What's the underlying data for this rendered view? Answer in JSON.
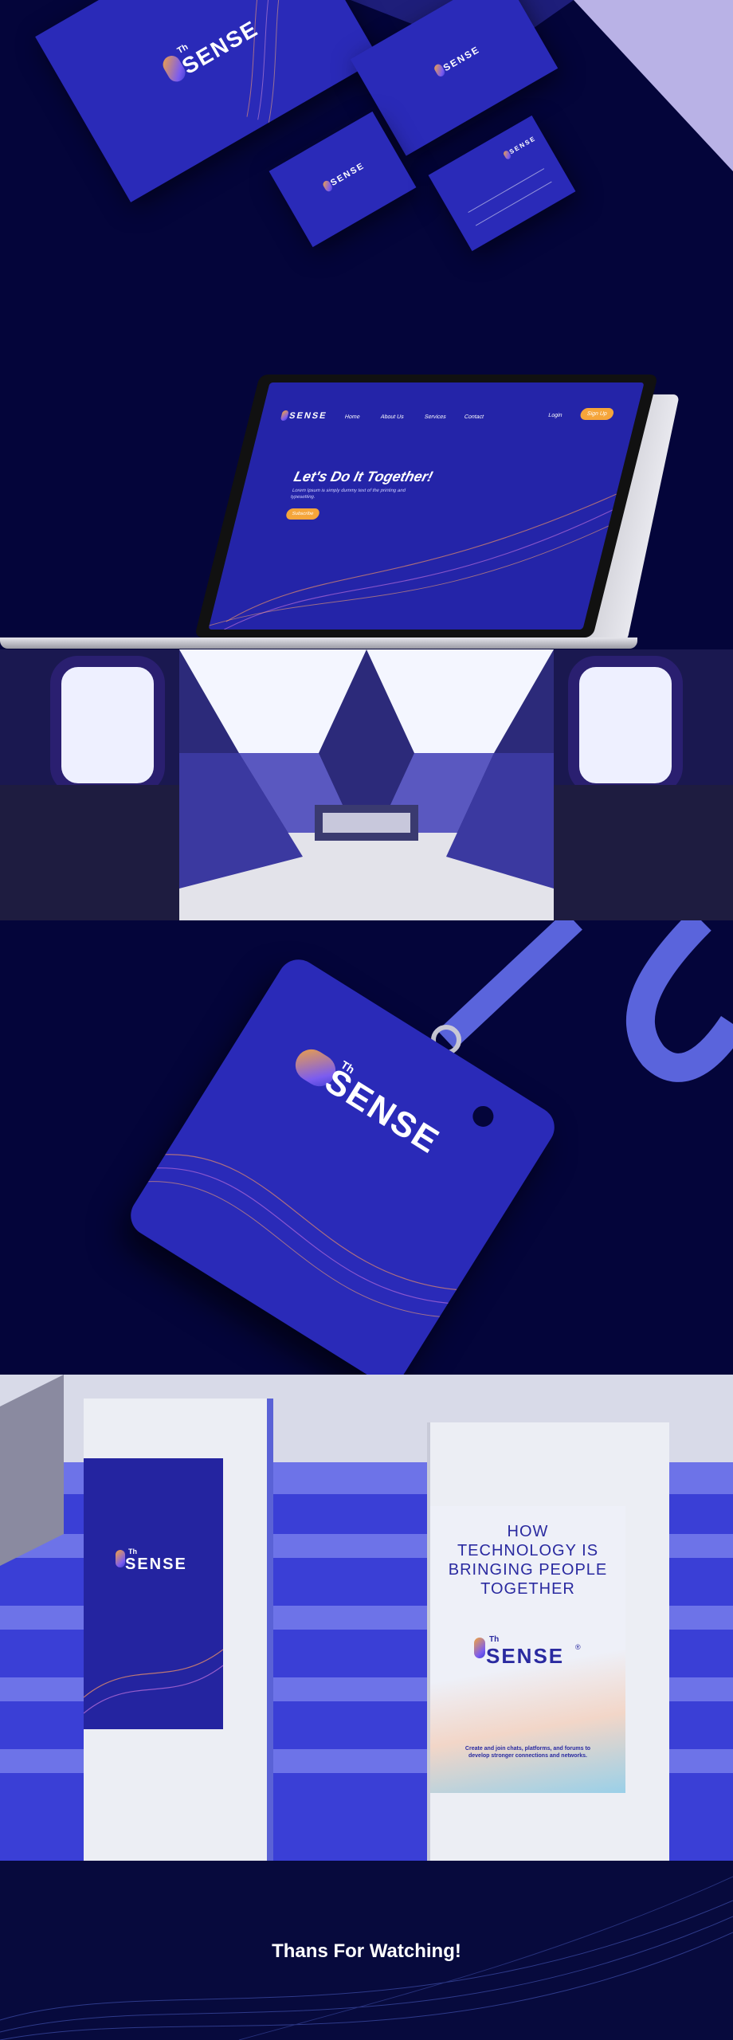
{
  "brand": {
    "super": "Th",
    "word": "SENSE",
    "reg": "®"
  },
  "website": {
    "nav": [
      "Home",
      "About Us",
      "Services",
      "Contact"
    ],
    "login": "Login",
    "signup": "Sign Up",
    "hero": "Let's Do It Together!",
    "body": "Lorem Ipsum is simply dummy text of the printing and typesetting.",
    "cta": "Subscribe"
  },
  "signage": {
    "headline": "HOW TECHNOLOGY IS BRINGING PEOPLE TOGETHER",
    "tagline": "Create and join chats, platforms, and forums to develop stronger connections and networks."
  },
  "footer": {
    "thanks": "Thans For Watching!"
  },
  "colors": {
    "navy": "#04053a",
    "brand_blue": "#2a2ab8",
    "accent_orange": "#f5a53a",
    "accent_purple": "#7b5cf0"
  }
}
